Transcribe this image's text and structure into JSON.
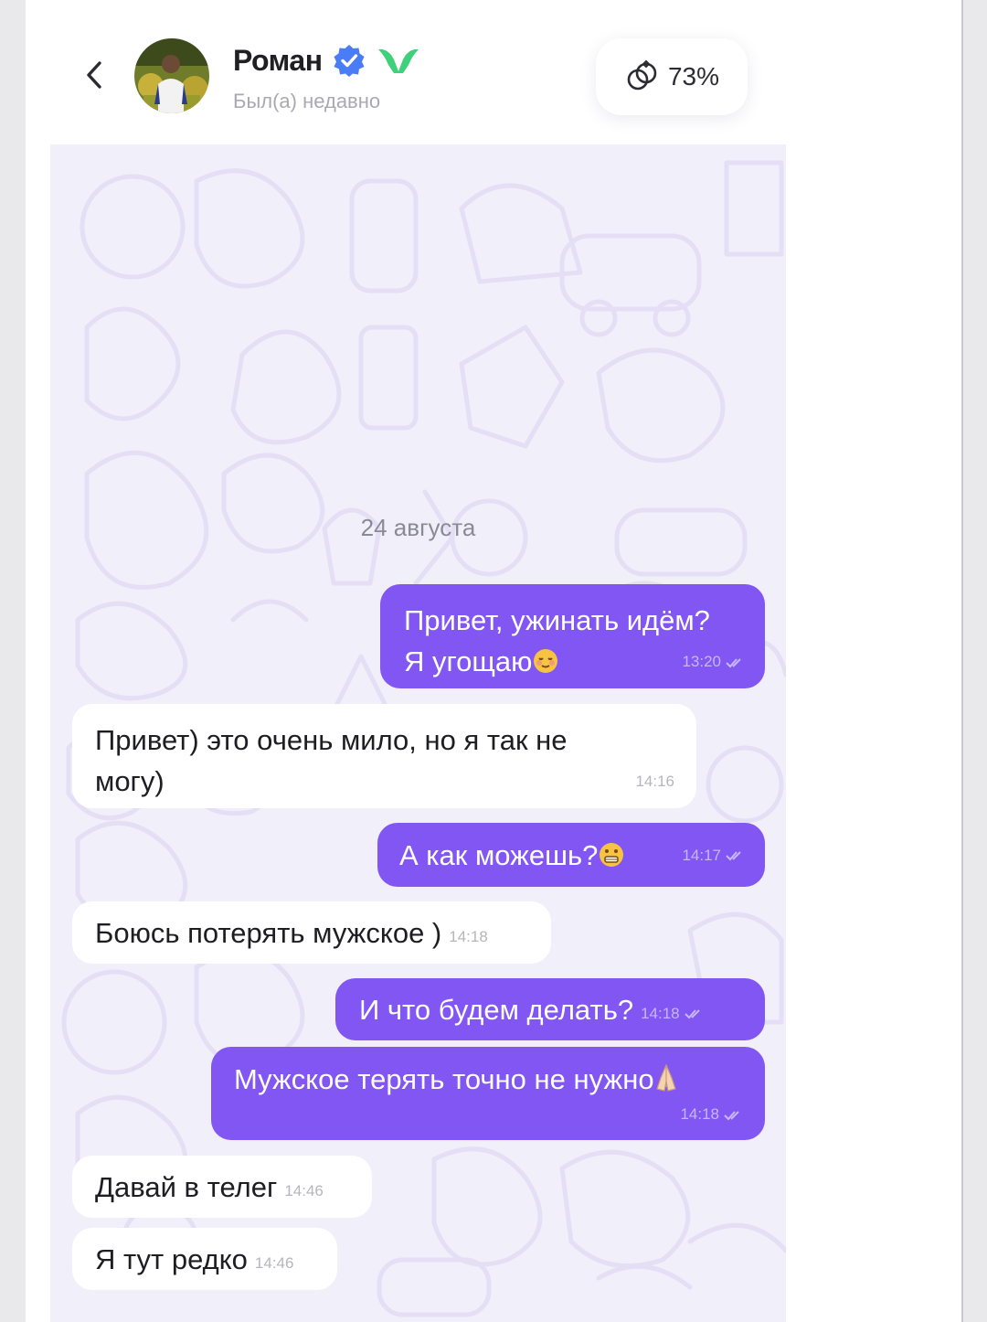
{
  "contact": {
    "name": "Роман",
    "status": "Был(а) недавно"
  },
  "match": {
    "value": "73%"
  },
  "chat": {
    "date_label": "24 августа",
    "messages": [
      {
        "direction": "out",
        "lines": [
          "Привет, ужинать идём?",
          "Я угощаю"
        ],
        "emoji": "relieved-face",
        "time": "13:20"
      },
      {
        "direction": "in",
        "lines": [
          "Привет) это очень мило, но я так не",
          "могу)"
        ],
        "time": "14:16"
      },
      {
        "direction": "out",
        "lines": [
          "А как можешь?"
        ],
        "emoji": "grimacing-face",
        "time": "14:17"
      },
      {
        "direction": "in",
        "lines": [
          "Боюсь потерять мужское )"
        ],
        "time": "14:18"
      },
      {
        "direction": "out",
        "lines": [
          "И что будем делать?"
        ],
        "time": "14:18"
      },
      {
        "direction": "out",
        "lines": [
          "Мужское терять точно не нужно"
        ],
        "emoji": "folded-hands",
        "time": "14:18"
      },
      {
        "direction": "in",
        "lines": [
          "Давай в телег"
        ],
        "time": "14:46"
      },
      {
        "direction": "in",
        "lines": [
          "Я тут редко"
        ],
        "time": "14:46"
      }
    ]
  },
  "colors": {
    "outgoing_bubble": "#8156f2",
    "incoming_bubble": "#ffffff",
    "chat_background": "#f1effa",
    "verified_badge": "#4a7cf5",
    "brand_mark": "#3ed07a"
  },
  "icons": [
    "back-arrow-icon",
    "verified-badge-icon",
    "brand-logo-icon",
    "rings-icon",
    "read-tick-icon"
  ]
}
